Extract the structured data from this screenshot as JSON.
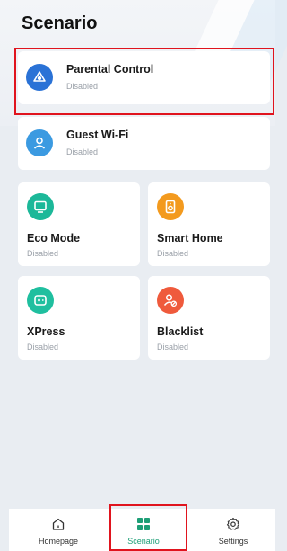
{
  "page": {
    "title": "Scenario"
  },
  "cards": {
    "parental": {
      "title": "Parental Control",
      "status": "Disabled",
      "icon": "parental-icon",
      "color": "#2a72d6"
    },
    "guest": {
      "title": "Guest Wi-Fi",
      "status": "Disabled",
      "icon": "guest-user-icon",
      "color": "#3b9ae1"
    },
    "eco": {
      "title": "Eco Mode",
      "status": "Disabled",
      "icon": "monitor-icon",
      "color": "#1cb899"
    },
    "smarthome": {
      "title": "Smart Home",
      "status": "Disabled",
      "icon": "speaker-icon",
      "color": "#f39a1e"
    },
    "xpress": {
      "title": "XPress",
      "status": "Disabled",
      "icon": "gamepad-icon",
      "color": "#1fbf9f"
    },
    "blacklist": {
      "title": "Blacklist",
      "status": "Disabled",
      "icon": "user-blocked-icon",
      "color": "#ef5a3c"
    }
  },
  "nav": {
    "home": {
      "label": "Homepage",
      "icon": "home-icon"
    },
    "scenario": {
      "label": "Scenario",
      "icon": "grid-icon",
      "color": "#1e9f77"
    },
    "settings": {
      "label": "Settings",
      "icon": "gear-icon"
    }
  },
  "colors": {
    "highlight": "#e0141e",
    "background": "#e9edf2"
  }
}
